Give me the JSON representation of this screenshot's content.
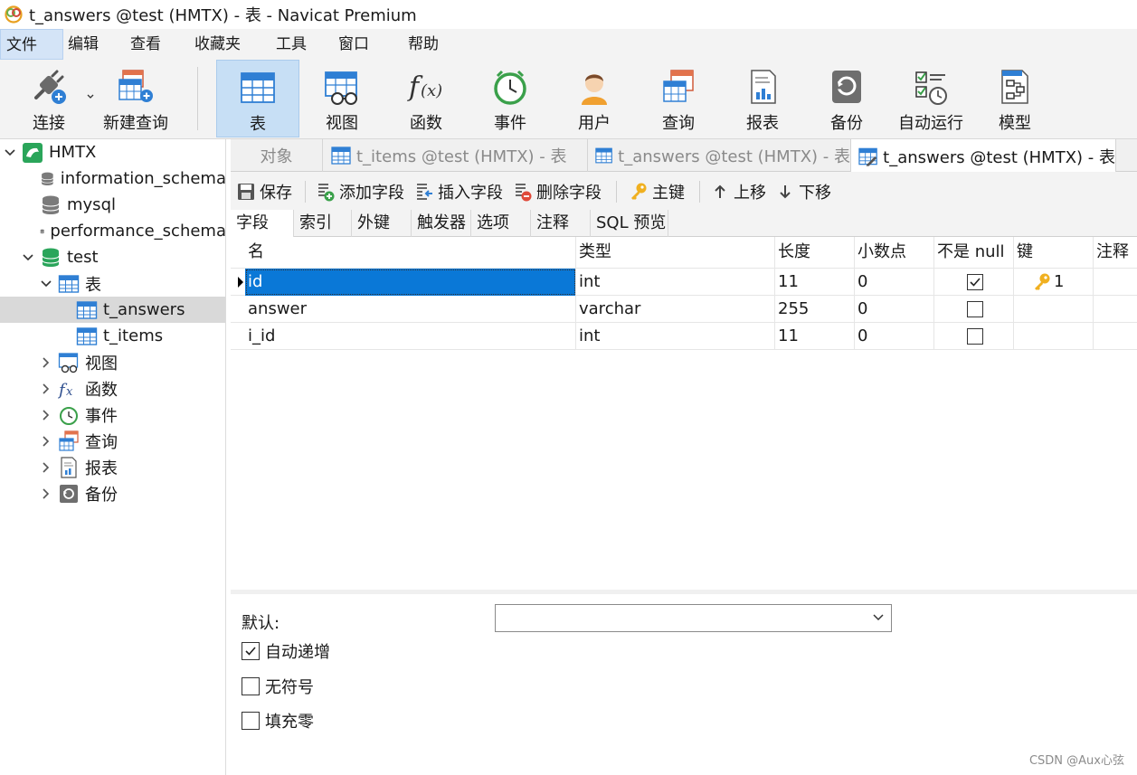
{
  "window": {
    "title": "t_answers @test (HMTX) - 表 - Navicat Premium"
  },
  "menubar": {
    "items": [
      "文件",
      "编辑",
      "查看",
      "收藏夹",
      "工具",
      "窗口",
      "帮助"
    ]
  },
  "toolbar": {
    "connect": "连接",
    "new_query": "新建查询",
    "table": "表",
    "view": "视图",
    "function": "函数",
    "event": "事件",
    "user": "用户",
    "query": "查询",
    "report": "报表",
    "backup": "备份",
    "automation": "自动运行",
    "model": "模型"
  },
  "sidebar": {
    "connection": "HMTX",
    "databases": [
      "information_schema",
      "mysql",
      "performance_schema",
      "test"
    ],
    "tables_group": "表",
    "tables": [
      "t_answers",
      "t_items"
    ],
    "groups": [
      "视图",
      "函数",
      "事件",
      "查询",
      "报表",
      "备份"
    ]
  },
  "tabs": {
    "objects": "对象",
    "items": [
      "t_items @test (HMTX) - 表",
      "t_answers @test (HMTX) - 表",
      "t_answers @test (HMTX) - 表"
    ]
  },
  "designer_toolbar": {
    "save": "保存",
    "add_field": "添加字段",
    "insert_field": "插入字段",
    "delete_field": "删除字段",
    "primary_key": "主键",
    "move_up": "上移",
    "move_down": "下移"
  },
  "designer_tabs": [
    "字段",
    "索引",
    "外键",
    "触发器",
    "选项",
    "注释",
    "SQL 预览"
  ],
  "grid": {
    "headers": [
      "名",
      "类型",
      "长度",
      "小数点",
      "不是 null",
      "键",
      "注释"
    ],
    "rows": [
      {
        "name": "id",
        "type": "int",
        "length": "11",
        "decimals": "0",
        "not_null": true,
        "key": "1"
      },
      {
        "name": "answer",
        "type": "varchar",
        "length": "255",
        "decimals": "0",
        "not_null": false,
        "key": ""
      },
      {
        "name": "i_id",
        "type": "int",
        "length": "11",
        "decimals": "0",
        "not_null": false,
        "key": ""
      }
    ]
  },
  "properties": {
    "default_label": "默认:",
    "default_value": "",
    "auto_increment": "自动递增",
    "auto_increment_checked": true,
    "unsigned": "无符号",
    "unsigned_checked": false,
    "zerofill": "填充零",
    "zerofill_checked": false
  },
  "watermark": "CSDN @Aux心弦",
  "colors": {
    "selection": "#0a78d7",
    "toolbar_active": "#c7dff5",
    "accent_blue": "#3b7fd4",
    "db_green": "#2aa55a"
  }
}
